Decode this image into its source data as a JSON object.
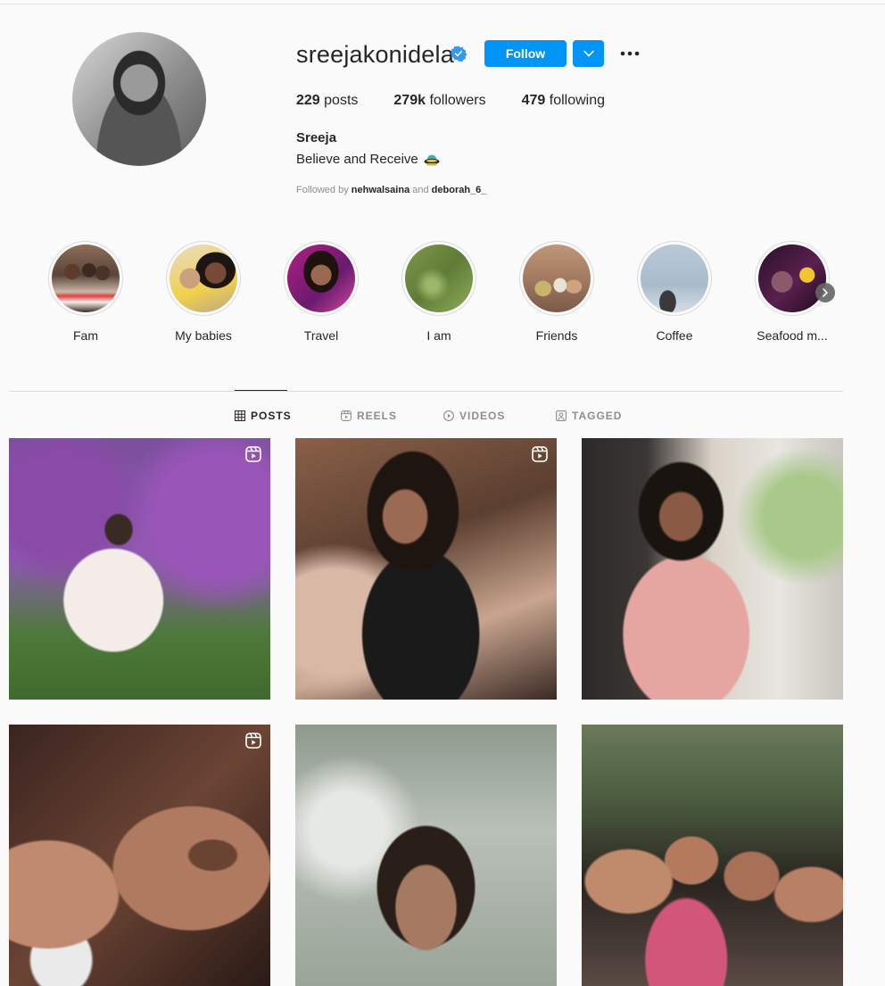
{
  "profile": {
    "username": "sreejakonidela",
    "follow_label": "Follow",
    "posts_count": "229",
    "posts_label": "posts",
    "followers_count": "279k",
    "followers_label": "followers",
    "following_count": "479",
    "following_label": "following",
    "full_name": "Sreeja",
    "bio": "Believe and Receive",
    "followed_by_prefix": "Followed by",
    "followed_by_1": "nehwalsaina",
    "followed_by_and": "and",
    "followed_by_2": "deborah_6_"
  },
  "highlights": [
    {
      "label": "Fam"
    },
    {
      "label": "My babies"
    },
    {
      "label": "Travel"
    },
    {
      "label": "I am"
    },
    {
      "label": "Friends"
    },
    {
      "label": "Coffee"
    },
    {
      "label": "Seafood m..."
    }
  ],
  "tabs": [
    {
      "label": "POSTS",
      "icon": "grid-icon",
      "active": true
    },
    {
      "label": "REELS",
      "icon": "reels-icon",
      "active": false
    },
    {
      "label": "VIDEOS",
      "icon": "play-icon",
      "active": false
    },
    {
      "label": "TAGGED",
      "icon": "tag-icon",
      "active": false
    }
  ],
  "colors": {
    "accent": "#0095f6",
    "background": "#fafafa",
    "text": "#262626",
    "muted": "#8e8e8e"
  }
}
